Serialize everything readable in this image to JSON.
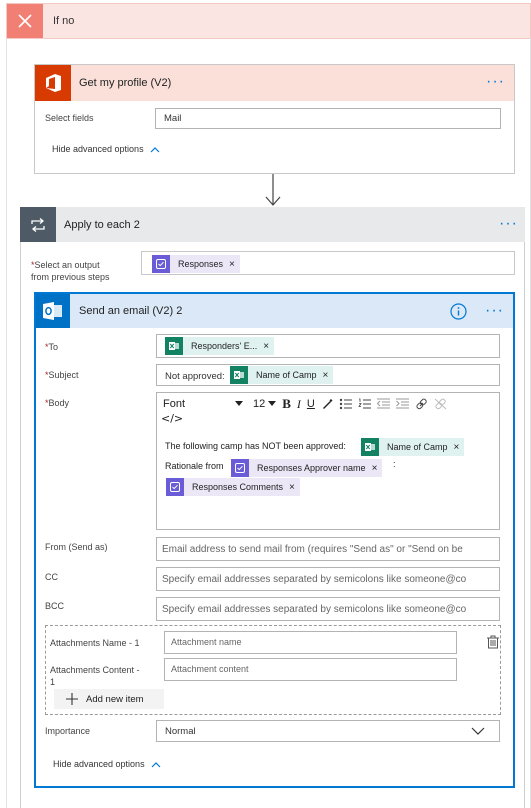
{
  "if_no": {
    "title": "If no"
  },
  "get_profile": {
    "title": "Get my profile (V2)",
    "select_fields_label": "Select fields",
    "select_fields_value": "Mail",
    "hide_advanced": "Hide advanced options"
  },
  "apply_each": {
    "title": "Apply to each 2",
    "select_output_label_1": "Select an output",
    "select_output_label_2": "from previous steps",
    "token": "Responses"
  },
  "send_email": {
    "title": "Send an email (V2) 2",
    "to_label": "To",
    "to_token": "Responders' E...",
    "subject_label": "Subject",
    "subject_prefix": "Not approved:",
    "subject_token": "Name of Camp",
    "body_label": "Body",
    "toolbar": {
      "font": "Font",
      "size": "12",
      "bold": "B",
      "italic": "I",
      "underline": "U",
      "code": "</>"
    },
    "body_line1": "The following camp has NOT been approved:",
    "body_token1": "Name of Camp",
    "body_line2": "Rationale from",
    "body_token2": "Responses Approver name",
    "body_colon": ":",
    "body_token3": "Responses Comments",
    "from_label": "From (Send as)",
    "from_placeholder": "Email address to send mail from (requires \"Send as\" or \"Send on be",
    "cc_label": "CC",
    "cc_placeholder": "Specify email addresses separated by semicolons like someone@co",
    "bcc_label": "BCC",
    "bcc_placeholder": "Specify email addresses separated by semicolons like someone@co",
    "att_name_label": "Attachments Name - 1",
    "att_name_placeholder": "Attachment name",
    "att_content_label_1": "Attachments Content -",
    "att_content_label_2": "1",
    "att_content_placeholder": "Attachment content",
    "add_new_item": "Add new item",
    "importance_label": "Importance",
    "importance_value": "Normal",
    "hide_advanced": "Hide advanced options"
  },
  "colors": {
    "if_no_header_bg": "#fbe5e3",
    "if_no_x_bg": "#f27f74",
    "office_red": "#d83b01",
    "loop_gray": "#4e5a66",
    "outlook_blue": "#0072c6",
    "accent": "#0078d4"
  }
}
